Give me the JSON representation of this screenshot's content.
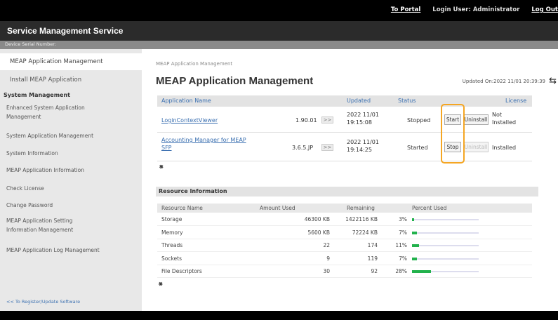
{
  "topbar": {
    "portal": "To Portal",
    "login_user": "Login User: Administrator",
    "logout": "Log Out"
  },
  "app_title": "Service Management Service",
  "serial": "Device Serial Number:",
  "sidebar": {
    "items": [
      {
        "label": "MEAP Application Management",
        "active": true
      },
      {
        "label": "Install MEAP Application"
      }
    ],
    "section_head": "System Management",
    "sys_items": [
      {
        "label": "Enhanced System Application\nManagement"
      },
      {
        "label": "System Application Management"
      },
      {
        "label": "System Information"
      },
      {
        "label": "MEAP Application Information"
      },
      {
        "label": "Check License"
      },
      {
        "label": "Change Password"
      },
      {
        "label": "MEAP Application Setting\nInformation Management"
      },
      {
        "label": "MEAP Application Log Management"
      }
    ],
    "register_link": "<< To Register/Update Software"
  },
  "main": {
    "breadcrumb": "MEAP Application Management",
    "title": "MEAP Application Management",
    "updated": "Updated On:2022 11/01 20:39:39",
    "refresh_icon": "refresh-icon"
  },
  "app_table": {
    "headers": [
      "Application Name",
      "Updated",
      "Status",
      "License"
    ],
    "rows": [
      {
        "name": "LoginContextViewer",
        "version": "1.90.01",
        "updated": "2022 11/01\n19:15:08",
        "status": "Stopped",
        "action": "Start",
        "uninstall": "Uninstall",
        "license": "Not\nInstalled"
      },
      {
        "name": "Accounting Manager for MEAP\nSFP",
        "version": "3.6.5.JP",
        "updated": "2022 11/01\n19:14:25",
        "status": "Started",
        "action": "Stop",
        "uninstall": "Uninstall",
        "license": "Installed"
      }
    ]
  },
  "resource": {
    "title": "Resource Information",
    "headers": [
      "Resource Name",
      "Amount Used",
      "Remaining",
      "Percent Used"
    ],
    "rows": [
      {
        "name": "Storage",
        "used": "46300 KB",
        "remaining": "1422116 KB",
        "percent": "3%",
        "fraction": 0.03
      },
      {
        "name": "Memory",
        "used": "5600 KB",
        "remaining": "72224 KB",
        "percent": "7%",
        "fraction": 0.07
      },
      {
        "name": "Threads",
        "used": "22",
        "remaining": "174",
        "percent": "11%",
        "fraction": 0.11
      },
      {
        "name": "Sockets",
        "used": "9",
        "remaining": "119",
        "percent": "7%",
        "fraction": 0.07
      },
      {
        "name": "File Descriptors",
        "used": "30",
        "remaining": "92",
        "percent": "28%",
        "fraction": 0.28
      }
    ]
  },
  "colors": {
    "accent_link": "#3a6fb0",
    "highlight": "#f5a623",
    "bar": "#22b24c"
  }
}
